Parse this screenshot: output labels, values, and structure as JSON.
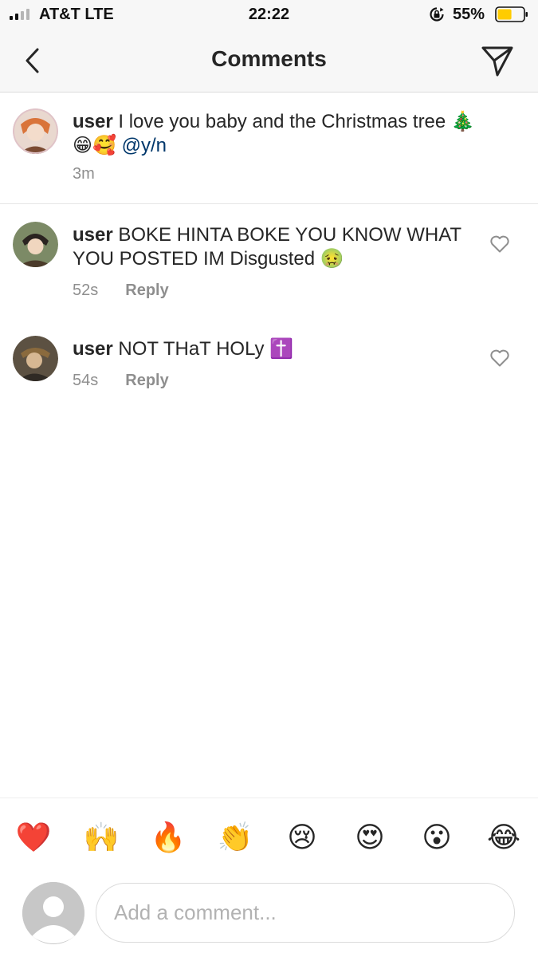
{
  "status_bar": {
    "carrier": "AT&T  LTE",
    "time": "22:22",
    "battery_percent": "55%",
    "battery_level": 0.55,
    "signal_bars_filled": 2,
    "battery_color": "#ffcc00"
  },
  "nav": {
    "title": "Comments",
    "back_icon": "chevron-left-icon",
    "send_icon": "paper-plane-icon"
  },
  "caption": {
    "username": "user",
    "text": " I love you baby and the Christmas tree 🎄 😁🥰",
    "mention": "@y/n",
    "time": "3m"
  },
  "comments": [
    {
      "username": "user",
      "text": " BOKE HINTA BOKE YOU KNOW WHAT YOU POSTED IM Disgusted 🤢",
      "time": "52s",
      "reply_label": "Reply"
    },
    {
      "username": "user",
      "text": " NOT THaT HOLy ✝️",
      "time": "54s",
      "reply_label": "Reply"
    }
  ],
  "emoji_bar": {
    "items": [
      "❤️",
      "🙌",
      "🔥",
      "👏",
      "😢",
      "😍",
      "😮",
      "😂"
    ]
  },
  "composer": {
    "placeholder": "Add a comment..."
  },
  "colors": {
    "text": "#262626",
    "secondary": "#8e8e8e",
    "mention": "#00376b",
    "bar_background": "#f7f7f7"
  }
}
